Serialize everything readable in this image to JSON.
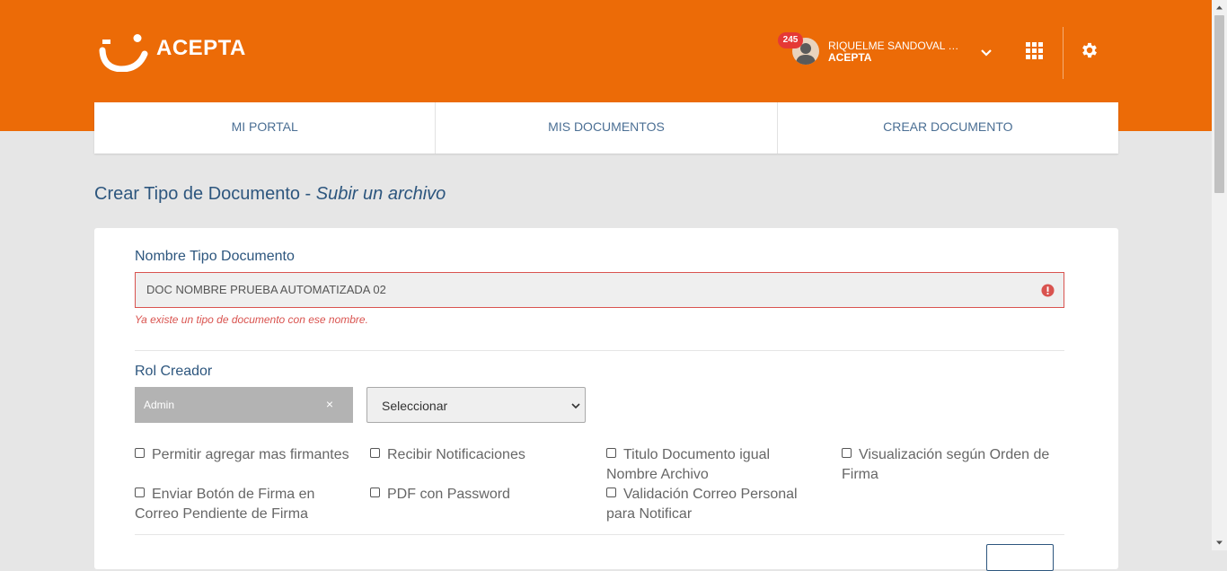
{
  "app": {
    "logo_text": "ACEPTA"
  },
  "header": {
    "notification_count": "245",
    "user_name": "RIQUELME SANDOVAL RU...",
    "user_org": "ACEPTA",
    "icons": [
      "chevron-down-icon",
      "apps-grid-icon",
      "gear-icon"
    ],
    "accent_color": "#ec6b07"
  },
  "nav": {
    "tabs": [
      {
        "label": "MI PORTAL"
      },
      {
        "label": "MIS DOCUMENTOS"
      },
      {
        "label": "CREAR DOCUMENTO"
      }
    ]
  },
  "page": {
    "title_main": "Crear Tipo de Documento - ",
    "title_sub": "Subir un archivo"
  },
  "form": {
    "name": {
      "label": "Nombre Tipo Documento",
      "value": "DOC NOMBRE PRUEBA AUTOMATIZADA 02",
      "error": "Ya existe un tipo de documento con ese nombre."
    },
    "role": {
      "label": "Rol Creador",
      "selected_tag": "Admin",
      "remove_symbol": "×",
      "select_value": "Seleccionar"
    },
    "options": [
      {
        "label": "Permitir agregar mas firmantes",
        "checked": false
      },
      {
        "label": "Recibir Notificaciones",
        "checked": false
      },
      {
        "label": "Titulo Documento igual Nombre Archivo",
        "checked": false
      },
      {
        "label": "Visualización según Orden de Firma",
        "checked": false
      },
      {
        "label": "Enviar Botón de Firma en Correo Pendiente de Firma",
        "checked": false
      },
      {
        "label": "PDF con Password",
        "checked": false
      },
      {
        "label": "Validación Correo Personal para Notificar",
        "checked": false
      }
    ],
    "error_color": "#d9534f"
  }
}
